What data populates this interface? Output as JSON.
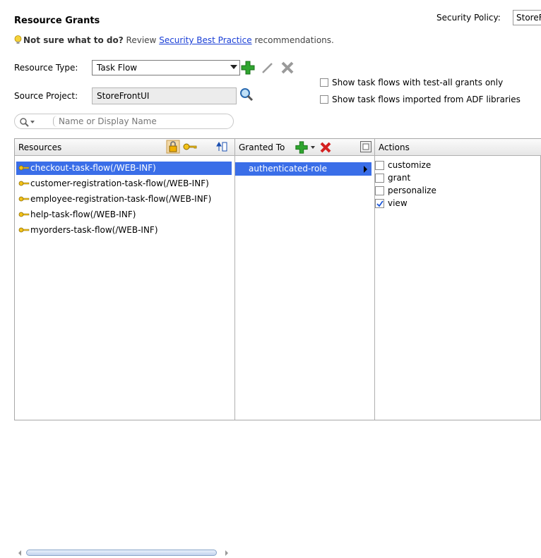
{
  "header": {
    "title": "Resource Grants",
    "security_policy_label": "Security Policy:",
    "security_policy_value": "StoreFront"
  },
  "hint": {
    "lead": "Not sure what to do?",
    "pre": "Review",
    "link": "Security Best Practice",
    "post": "recommendations."
  },
  "resource_type": {
    "label": "Resource Type:",
    "value": "Task Flow"
  },
  "source_project": {
    "label": "Source Project:",
    "value": "StoreFrontUI"
  },
  "options": [
    {
      "label": "Show task flows with test-all grants only",
      "checked": false
    },
    {
      "label": "Show task flows imported from ADF libraries",
      "checked": false
    }
  ],
  "search": {
    "placeholder": "Name or Display Name"
  },
  "grid": {
    "resources_header": "Resources",
    "granted_to_header": "Granted To",
    "actions_header": "Actions",
    "resources": [
      "checkout-task-flow(/WEB-INF)",
      "customer-registration-task-flow(/WEB-INF)",
      "employee-registration-task-flow(/WEB-INF)",
      "help-task-flow(/WEB-INF)",
      "myorders-task-flow(/WEB-INF)"
    ],
    "granted_to": [
      "authenticated-role"
    ],
    "actions": [
      {
        "label": "customize",
        "checked": false
      },
      {
        "label": "grant",
        "checked": false
      },
      {
        "label": "personalize",
        "checked": false
      },
      {
        "label": "view",
        "checked": true
      }
    ]
  },
  "colors": {
    "selection": "#3a6ee8",
    "link": "#1a3fd6",
    "add_green": "#2fa52f",
    "delete_red": "#d42020"
  }
}
